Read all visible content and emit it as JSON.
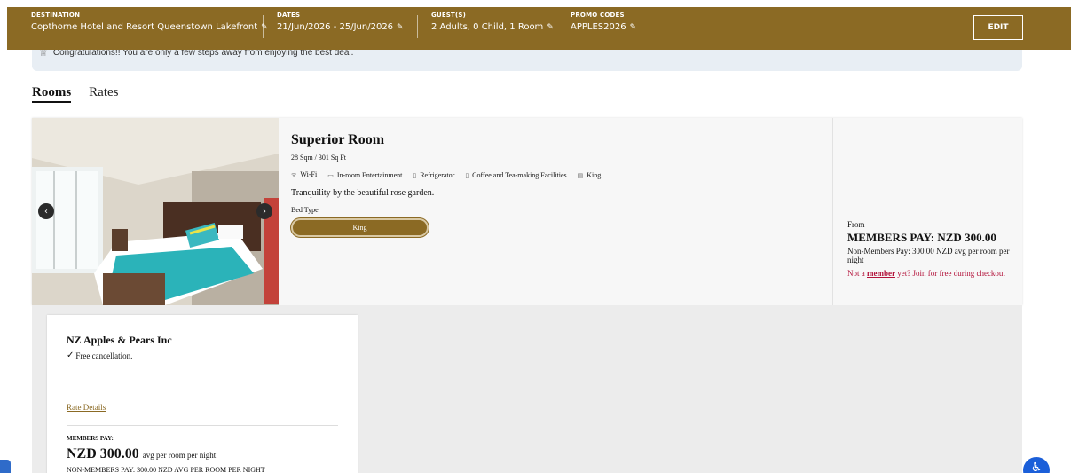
{
  "header": {
    "destination": {
      "label": "DESTINATION",
      "value": "Copthorne Hotel and Resort Queenstown Lakefront"
    },
    "dates": {
      "label": "DATES",
      "value": "21/Jun/2026 - 25/Jun/2026"
    },
    "guests": {
      "label": "GUEST(S)",
      "value": "2 Adults, 0 Child, 1 Room"
    },
    "promo": {
      "label": "PROMO CODES",
      "value": "APPLES2026"
    },
    "edit_label": "EDIT"
  },
  "notice": {
    "text": "Congratulations!! You are only a few steps away from enjoying the best deal."
  },
  "tabs": [
    {
      "label": "Rooms",
      "active": true
    },
    {
      "label": "Rates",
      "active": false
    }
  ],
  "room": {
    "name": "Superior Room",
    "size": "28 Sqm / 301 Sq Ft",
    "amenities": [
      {
        "icon": "wifi-icon",
        "label": "Wi-Fi"
      },
      {
        "icon": "tv-icon",
        "label": "In-room Entertainment"
      },
      {
        "icon": "fridge-icon",
        "label": "Refrigerator"
      },
      {
        "icon": "kettle-icon",
        "label": "Coffee and Tea-making Facilities"
      },
      {
        "icon": "bed-icon",
        "label": "King"
      }
    ],
    "description": "Tranquility by the beautiful rose garden.",
    "bed_type_label": "Bed Type",
    "bed_option": "King",
    "price": {
      "from": "From",
      "members": "MEMBERS PAY: NZD 300.00",
      "non_members": "Non-Members Pay: 300.00 NZD avg per room per night",
      "not_a": "Not a ",
      "member_link": "member",
      "join": " yet? Join for free during checkout"
    }
  },
  "rate": {
    "name": "NZ Apples & Pears Inc",
    "cancellation": "Free cancellation.",
    "details_link": "Rate Details",
    "members_label": "MEMBERS PAY:",
    "members_amount": "NZD 300.00",
    "members_suffix": "avg per room per night",
    "non_members": "NON-MEMBERS PAY: 300.00 NZD AVG PER ROOM PER NIGHT"
  },
  "colors": {
    "brand": "#8b6a24",
    "link_red": "#b3123a",
    "notice_bg": "#e8eef4"
  }
}
